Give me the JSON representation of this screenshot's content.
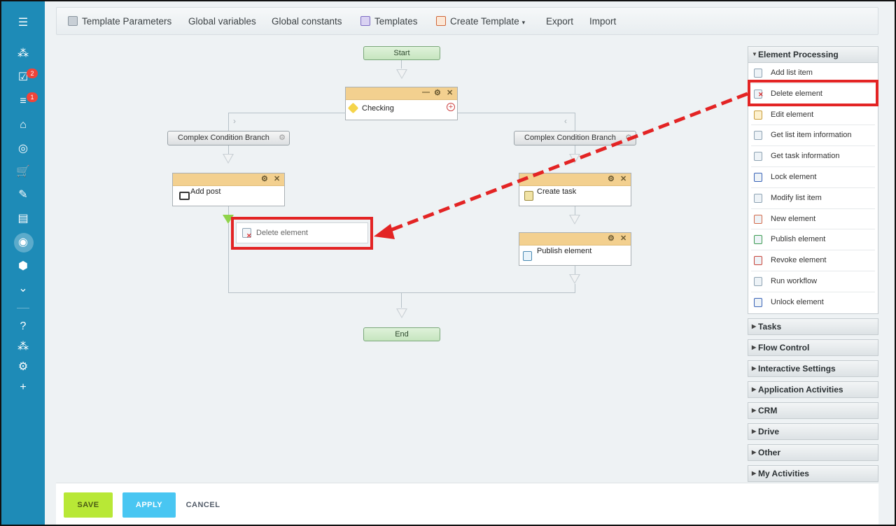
{
  "toolbar": {
    "template_parameters": "Template Parameters",
    "global_variables": "Global variables",
    "global_constants": "Global constants",
    "templates": "Templates",
    "create_template": "Create Template",
    "create_template_caret": "▾",
    "export": "Export",
    "import": "Import"
  },
  "rail": {
    "badge_tasks": "2",
    "badge_filter": "1"
  },
  "workflow": {
    "start": "Start",
    "end": "End",
    "checking": "Checking",
    "branch_left": "Complex Condition Branch",
    "branch_right": "Complex Condition Branch",
    "add_post": "Add post",
    "create_task": "Create task",
    "publish_element": "Publish element",
    "dropped_element": "Delete element"
  },
  "sidebar": {
    "expanded_group": "Element Processing",
    "items": [
      "Add list item",
      "Delete element",
      "Edit element",
      "Get list item information",
      "Get task information",
      "Lock element",
      "Modify list item",
      "New element",
      "Publish element",
      "Revoke element",
      "Run workflow",
      "Unlock element"
    ],
    "groups": [
      "Tasks",
      "Flow Control",
      "Interactive Settings",
      "Application Activities",
      "CRM",
      "Drive",
      "Other",
      "My Activities"
    ]
  },
  "actions": {
    "save": "SAVE",
    "apply": "APPLY",
    "cancel": "CANCEL"
  },
  "colors": {
    "rail": "#1e8bb7",
    "save": "#b8e836",
    "apply": "#49c6f2",
    "highlight": "#e32424"
  }
}
